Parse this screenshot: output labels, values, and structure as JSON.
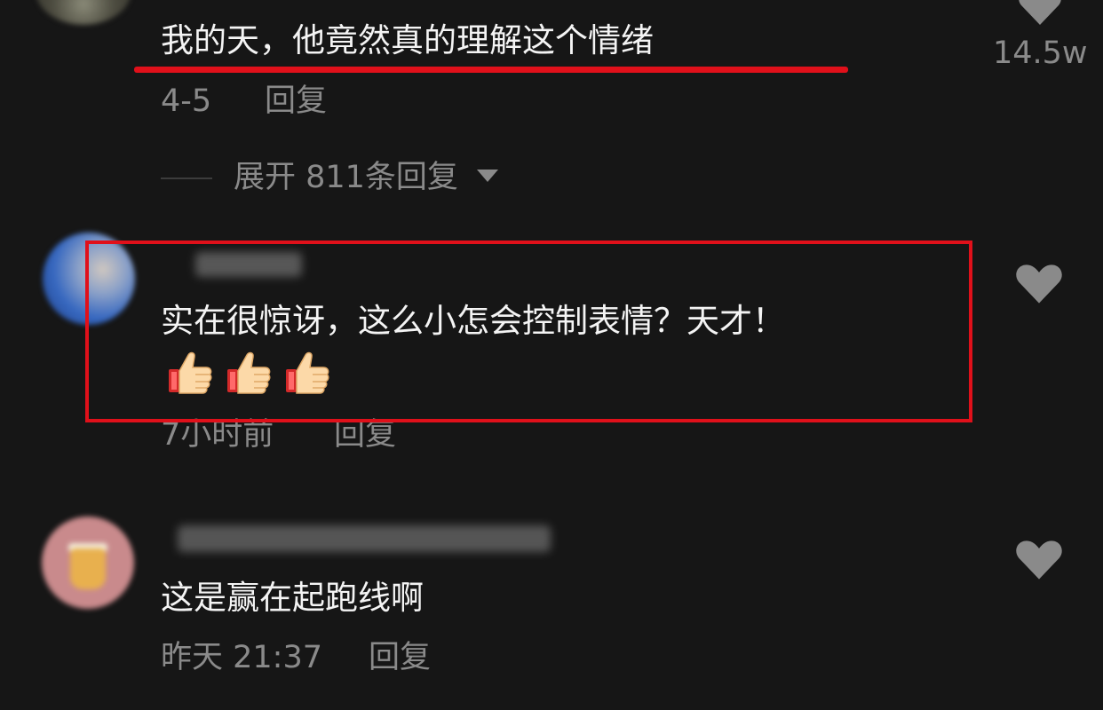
{
  "comments": [
    {
      "text": "我的天，他竟然真的理解这个情绪",
      "date": "4-5",
      "reply_label": "回复",
      "like_count": "14.5w",
      "expand_label": "展开 811条回复"
    },
    {
      "text": "实在很惊讶，这么小怎会控制表情？天才！",
      "emoji": [
        "thumbs-up",
        "thumbs-up",
        "thumbs-up"
      ],
      "date": "7小时前",
      "reply_label": "回复"
    },
    {
      "text": "这是赢在起跑线啊",
      "date": "昨天 21:37",
      "reply_label": "回复"
    }
  ],
  "colors": {
    "background": "#161616",
    "text": "#f4f4f4",
    "meta": "#8a8a8a",
    "like_icon": "#8a8a8a",
    "highlight": "#e0101a"
  },
  "icons": {
    "like": "heart-icon",
    "collapse": "caret-down-icon",
    "emoji": "thumbs-up-icon"
  }
}
